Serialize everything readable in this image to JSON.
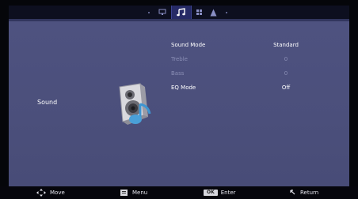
{
  "tabs": [
    {
      "icon": "dot-icon",
      "active": false
    },
    {
      "icon": "monitor-icon",
      "active": false
    },
    {
      "icon": "music-note-icon",
      "active": true
    },
    {
      "icon": "grid-icon",
      "active": false
    },
    {
      "icon": "lock-icon",
      "active": false
    },
    {
      "icon": "dot-icon",
      "active": false
    }
  ],
  "page": {
    "title": "Sound"
  },
  "settings": [
    {
      "label": "Sound Mode",
      "value": "Standard",
      "enabled": true
    },
    {
      "label": "Treble",
      "value": "0",
      "enabled": false
    },
    {
      "label": "Bass",
      "value": "0",
      "enabled": false
    },
    {
      "label": "EQ Mode",
      "value": "Off",
      "enabled": true
    }
  ],
  "footer": {
    "move": "Move",
    "menu": "Menu",
    "ok_key": "OK",
    "enter": "Enter",
    "return": "Return"
  },
  "colors": {
    "panel": "#4e5280",
    "tab_active": "#262a66",
    "speaker_note": "#4aa0d8"
  }
}
